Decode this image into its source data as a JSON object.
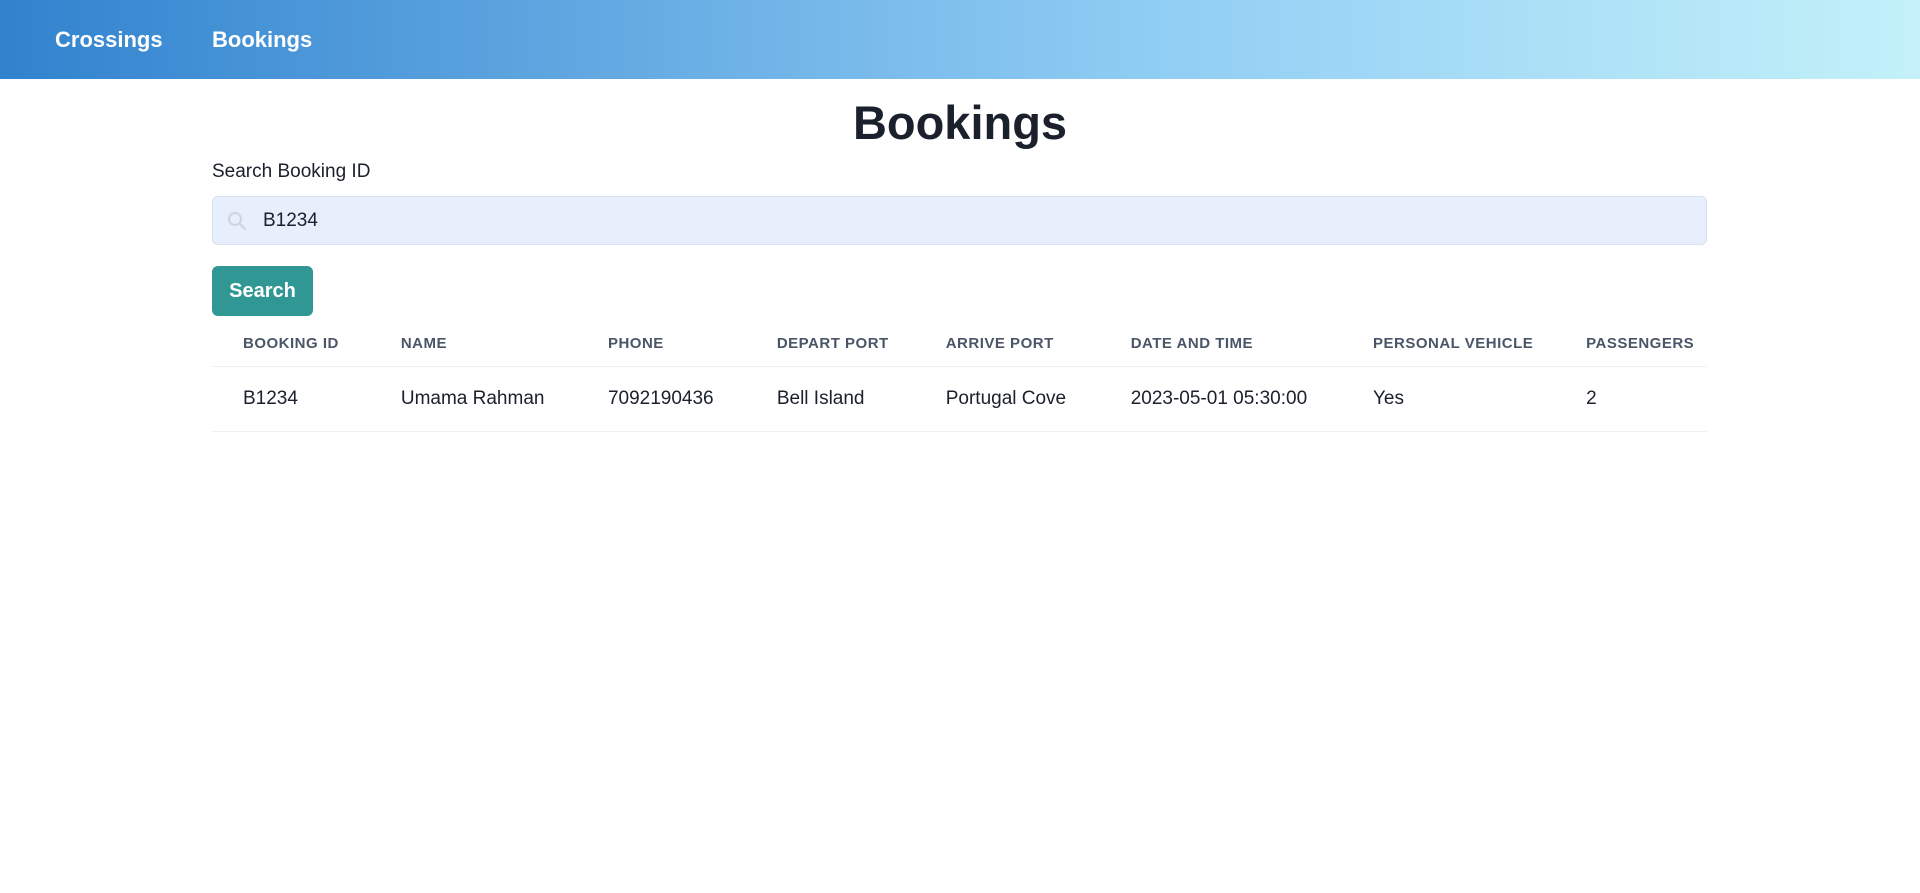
{
  "nav": {
    "crossings_label": "Crossings",
    "bookings_label": "Bookings"
  },
  "page": {
    "title": "Bookings"
  },
  "search": {
    "label": "Search Booking ID",
    "value": "B1234",
    "button_label": "Search"
  },
  "table": {
    "headers": [
      "BOOKING ID",
      "NAME",
      "PHONE",
      "DEPART PORT",
      "ARRIVE PORT",
      "DATE AND TIME",
      "PERSONAL VEHICLE",
      "PASSENGERS"
    ],
    "rows": [
      [
        "B1234",
        "Umama Rahman",
        "7092190436",
        "Bell Island",
        "Portugal Cove",
        "2023-05-01 05:30:00",
        "Yes",
        "2"
      ]
    ]
  },
  "colors": {
    "nav_gradient_start": "#3182ce",
    "nav_gradient_end": "#c4f1f9",
    "button": "#319795",
    "input_bg": "#e8effc"
  },
  "icons": {
    "search": "search-icon"
  }
}
